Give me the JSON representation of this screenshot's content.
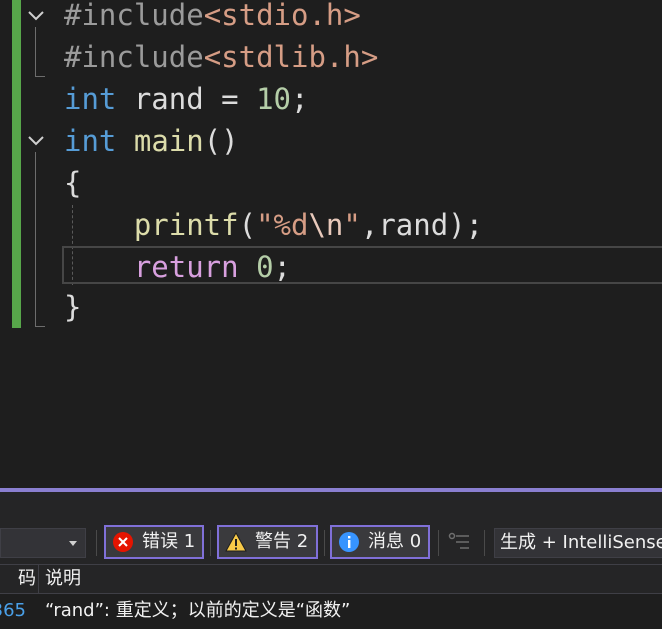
{
  "colors": {
    "keyword": "#569cd6",
    "control_keyword": "#d8a0df",
    "function": "#dcdcaa",
    "string": "#d69d85",
    "escape": "#e8c9bb",
    "number": "#b5cea8",
    "preprocessor": "#9b9b9b",
    "plain": "#dcdcdc",
    "change_bar": "#57a64a",
    "accent": "#8070d8",
    "error_code_link": "#4aa0e8"
  },
  "editor": {
    "lines": [
      {
        "tokens": [
          {
            "text": "#include",
            "color": "#9b9b9b"
          },
          {
            "text": "<stdio.h>",
            "color": "#d69d85"
          }
        ]
      },
      {
        "tokens": [
          {
            "text": "#include",
            "color": "#9b9b9b"
          },
          {
            "text": "<stdlib.h>",
            "color": "#d69d85"
          }
        ]
      },
      {
        "tokens": [
          {
            "text": "int",
            "color": "#569cd6"
          },
          {
            "text": " rand = ",
            "color": "#dcdcdc"
          },
          {
            "text": "10",
            "color": "#b5cea8"
          },
          {
            "text": ";",
            "color": "#dcdcdc"
          }
        ]
      },
      {
        "tokens": [
          {
            "text": "int",
            "color": "#569cd6"
          },
          {
            "text": " ",
            "color": "#dcdcdc"
          },
          {
            "text": "main",
            "color": "#dcdcaa"
          },
          {
            "text": "()",
            "color": "#dcdcdc"
          }
        ]
      },
      {
        "tokens": [
          {
            "text": "{",
            "color": "#dcdcdc"
          }
        ]
      },
      {
        "tokens": [
          {
            "text": "    ",
            "color": "#dcdcdc"
          },
          {
            "text": "printf",
            "color": "#dcdcaa"
          },
          {
            "text": "(",
            "color": "#dcdcdc"
          },
          {
            "text": "\"%d",
            "color": "#d69d85"
          },
          {
            "text": "\\n",
            "color": "#e8c9bb"
          },
          {
            "text": "\"",
            "color": "#d69d85"
          },
          {
            "text": ",rand);",
            "color": "#dcdcdc"
          }
        ]
      },
      {
        "tokens": [
          {
            "text": "    ",
            "color": "#dcdcdc"
          },
          {
            "text": "return",
            "color": "#d8a0df"
          },
          {
            "text": " ",
            "color": "#dcdcdc"
          },
          {
            "text": "0",
            "color": "#b5cea8"
          },
          {
            "text": ";",
            "color": "#dcdcdc"
          }
        ]
      },
      {
        "tokens": [
          {
            "text": "}",
            "color": "#dcdcdc"
          }
        ]
      }
    ],
    "fold_icons": [
      "chevron-down-icon",
      "chevron-down-icon"
    ]
  },
  "error_list": {
    "filters": {
      "errors": {
        "label": "错误 1",
        "icon": "error-icon"
      },
      "warnings": {
        "label": "警告 2",
        "icon": "warning-icon"
      },
      "messages": {
        "label": "消息 0",
        "icon": "info-icon"
      }
    },
    "filter_icon": "filter-icon",
    "source": "生成 + IntelliSense",
    "columns": {
      "code": "码",
      "description": "说明"
    },
    "rows": [
      {
        "code": "365",
        "description": "“rand”: 重定义；以前的定义是“函数”"
      }
    ]
  }
}
